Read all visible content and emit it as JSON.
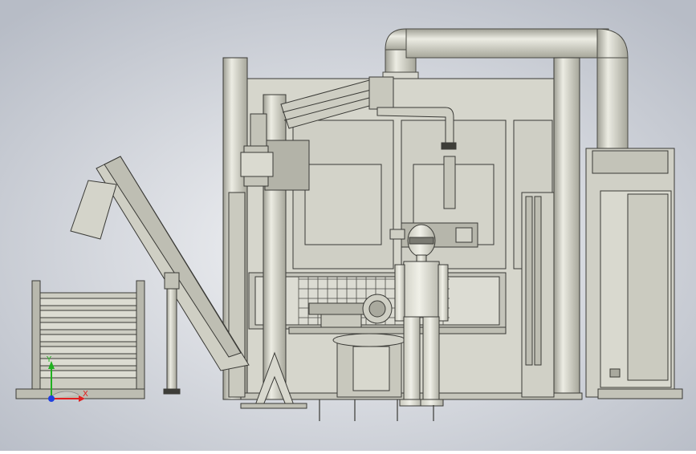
{
  "viewport": {
    "background_center": "#f4f5f7",
    "background_edge": "#b7bcc6"
  },
  "palette": {
    "steel": "#cfcfc3",
    "steel_light": "#e4e4da",
    "steel_dark": "#a9a99c",
    "outline": "#3a3a36",
    "panel_grey": "#b8b8ad",
    "grid": "#4a4a46"
  },
  "triad": {
    "x_label": "X",
    "y_label": "Y",
    "x_color": "#e02020",
    "y_color": "#20b020",
    "z_color": "#2040e0"
  }
}
